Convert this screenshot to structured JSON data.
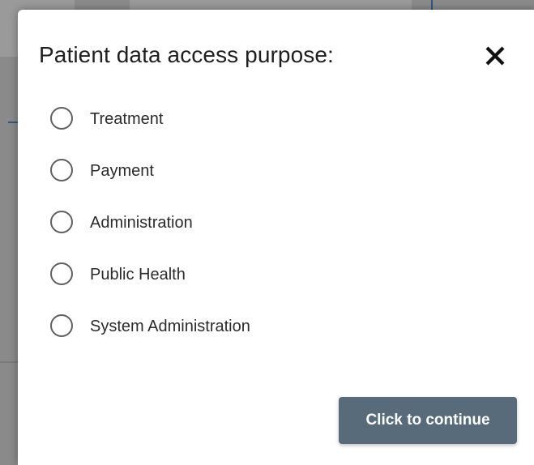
{
  "dialog": {
    "title": "Patient data access purpose:",
    "close_icon": "close-icon",
    "options": [
      {
        "label": "Treatment",
        "selected": false
      },
      {
        "label": "Payment",
        "selected": false
      },
      {
        "label": "Administration",
        "selected": false
      },
      {
        "label": "Public Health",
        "selected": false
      },
      {
        "label": "System Administration",
        "selected": false
      }
    ],
    "continue_label": "Click to continue"
  },
  "colors": {
    "button": "#576b7b",
    "overlay": "#8a8a8a"
  }
}
